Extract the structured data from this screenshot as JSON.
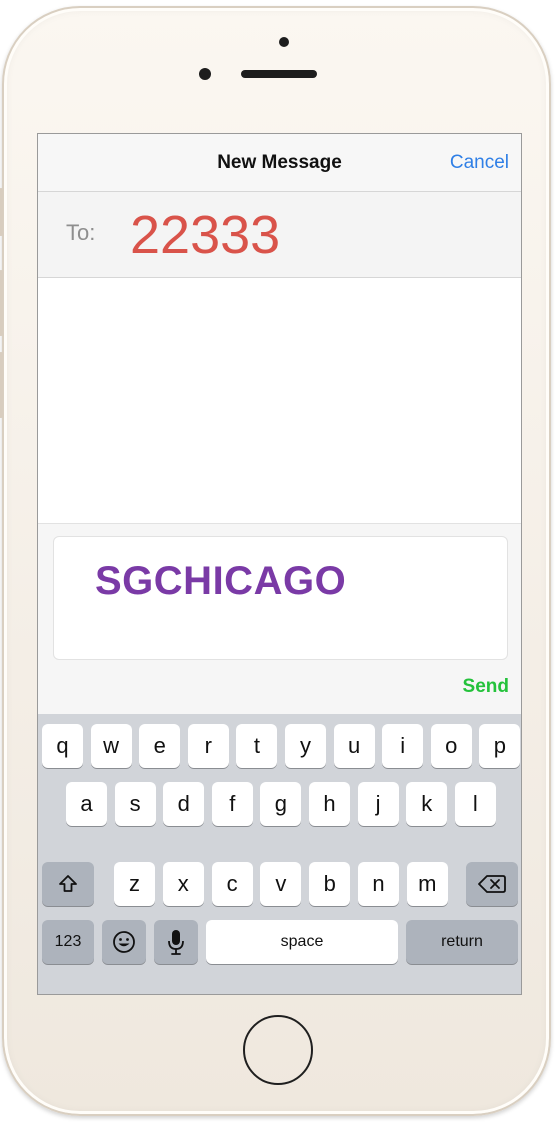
{
  "device": {
    "home_button_icon": "home-button",
    "frame_color": "#f4eee6"
  },
  "nav": {
    "title": "New Message",
    "cancel_label": "Cancel"
  },
  "recipient": {
    "label": "To:",
    "value": "22333",
    "value_color": "#d9534a"
  },
  "compose": {
    "text": "SGCHICAGO",
    "text_color": "#7a3aa6",
    "send_label": "Send",
    "send_color": "#24c23b"
  },
  "keyboard": {
    "row1": [
      "q",
      "w",
      "e",
      "r",
      "t",
      "y",
      "u",
      "i",
      "o",
      "p"
    ],
    "row2": [
      "a",
      "s",
      "d",
      "f",
      "g",
      "h",
      "j",
      "k",
      "l"
    ],
    "row3": [
      "z",
      "x",
      "c",
      "v",
      "b",
      "n",
      "m"
    ],
    "shift_icon": "shift-icon",
    "backspace_icon": "backspace-icon",
    "numbers_label": "123",
    "emoji_icon": "emoji-icon",
    "mic_icon": "microphone-icon",
    "space_label": "space",
    "return_label": "return"
  }
}
